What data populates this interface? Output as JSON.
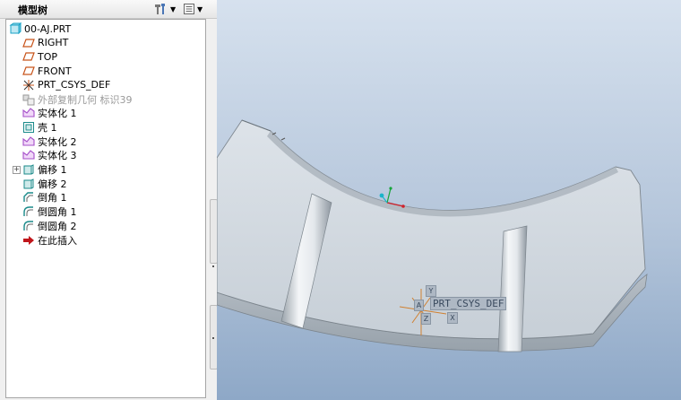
{
  "panel": {
    "title": "模型树",
    "header_buttons": [
      {
        "icon": "settings-tools-icon"
      },
      {
        "icon": "show-menu-icon"
      }
    ]
  },
  "tree": {
    "items": [
      {
        "label": "00-AJ.PRT",
        "icon": "part-icon",
        "color": "#1aa3c7",
        "indent": 0,
        "disabled": false
      },
      {
        "label": "RIGHT",
        "icon": "datum-plane-icon",
        "color": "#c8531a",
        "indent": 1,
        "disabled": false
      },
      {
        "label": "TOP",
        "icon": "datum-plane-icon",
        "color": "#c8531a",
        "indent": 1,
        "disabled": false
      },
      {
        "label": "FRONT",
        "icon": "datum-plane-icon",
        "color": "#c8531a",
        "indent": 1,
        "disabled": false
      },
      {
        "label": "PRT_CSYS_DEF",
        "icon": "coordinate-system-icon",
        "color": "#c8531a",
        "indent": 1,
        "disabled": false
      },
      {
        "label": "外部复制几何 标识39",
        "icon": "external-copy-geometry-icon",
        "color": "#9a9a9a",
        "indent": 1,
        "disabled": true
      },
      {
        "label": "实体化 1",
        "icon": "solidify-icon",
        "color": "#a54fc9",
        "indent": 1,
        "disabled": false
      },
      {
        "label": "壳 1",
        "icon": "shell-icon",
        "color": "#1a8a8a",
        "indent": 1,
        "disabled": false
      },
      {
        "label": "实体化 2",
        "icon": "solidify-icon",
        "color": "#a54fc9",
        "indent": 1,
        "disabled": false
      },
      {
        "label": "实体化 3",
        "icon": "solidify-icon",
        "color": "#a54fc9",
        "indent": 1,
        "disabled": false
      },
      {
        "label": "偏移 1",
        "icon": "offset-icon",
        "color": "#1a8a8a",
        "indent": 1,
        "disabled": false,
        "expandable": true
      },
      {
        "label": "偏移 2",
        "icon": "offset-icon",
        "color": "#1a8a8a",
        "indent": 1,
        "disabled": false
      },
      {
        "label": "倒角 1",
        "icon": "chamfer-icon",
        "color": "#1a8a8a",
        "indent": 1,
        "disabled": false
      },
      {
        "label": "倒圆角 1",
        "icon": "round-icon",
        "color": "#1a8a8a",
        "indent": 1,
        "disabled": false
      },
      {
        "label": "倒圆角 2",
        "icon": "round-icon",
        "color": "#1a8a8a",
        "indent": 1,
        "disabled": false
      },
      {
        "label": "在此插入",
        "icon": "insert-here-arrow-icon",
        "color": "#c0161b",
        "indent": 1,
        "disabled": false
      }
    ]
  },
  "viewport": {
    "csys_label": "PRT_CSYS_DEF",
    "axis_labels": {
      "x": "X",
      "y": "Y",
      "z": "Z",
      "a": "A"
    },
    "colors": {
      "background_top": "#d6e1ee",
      "background_bottom": "#8ea8c7",
      "part_fill": "#cfd6dd",
      "edge": "#7c858d"
    }
  }
}
